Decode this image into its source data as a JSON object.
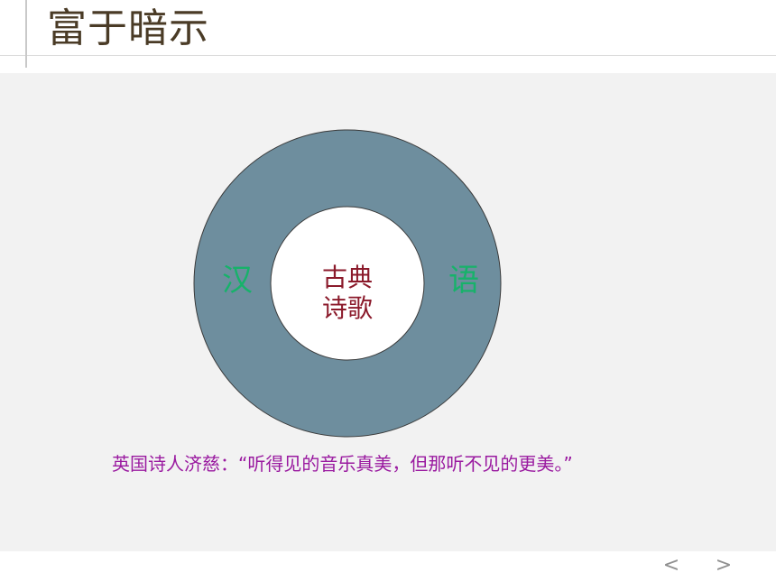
{
  "slide": {
    "title": "富于暗示",
    "ring": {
      "left_label": "汉",
      "right_label": "语",
      "center_line1": "古典",
      "center_line2": "诗歌",
      "ring_color": "#6e8e9e",
      "label_color": "#17b26a",
      "center_color": "#8b1a2b"
    },
    "quote": "英国诗人济慈：“听得见的音乐真美，但那听不见的更美。”",
    "quote_color": "#9a1aa0"
  },
  "navigation": {
    "prev_icon": "<",
    "next_icon": ">"
  }
}
